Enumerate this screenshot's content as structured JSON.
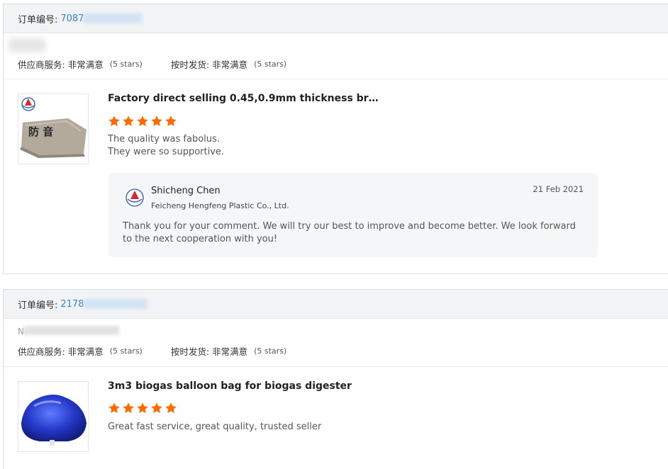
{
  "orders": [
    {
      "order_label": "订单编号:",
      "order_number_visible": "7087",
      "ratings": {
        "supplier_service_label": "供应商服务:",
        "supplier_service_value": "非常满意",
        "supplier_service_stars": "(5 stars)",
        "on_time_label": "按时发货:",
        "on_time_value": "非常满意",
        "on_time_stars": "(5 stars)"
      },
      "product": {
        "title": "Factory direct selling 0.45,0.9mm thickness br…",
        "rating": 5,
        "comment_lines": [
          "The quality was fabolus.",
          "They were so supportive."
        ],
        "image_text": "防 音"
      },
      "reply": {
        "name": "Shicheng Chen",
        "company": "Feicheng Hengfeng Plastic Co., Ltd.",
        "date": "21 Feb 2021",
        "text": "Thank you for your comment. We will try our best to improve and become better. We look forward to the next cooperation with you!"
      }
    },
    {
      "order_label": "订单编号:",
      "order_number_visible": "2178",
      "buyer_visible": "N",
      "ratings": {
        "supplier_service_label": "供应商服务:",
        "supplier_service_value": "非常满意",
        "supplier_service_stars": "(5 stars)",
        "on_time_label": "按时发货:",
        "on_time_value": "非常满意",
        "on_time_stars": "(5 stars)"
      },
      "product": {
        "title": "3m3 biogas balloon bag for biogas digester",
        "rating": 5,
        "comment": "Great fast service, great quality, trusted seller"
      }
    }
  ],
  "colors": {
    "accent_link": "#2f86d6",
    "star": "#ff6a00",
    "header_bg": "#f2f3f5",
    "reply_bg": "#f5f6f8"
  },
  "icons": {
    "star": "star-icon",
    "supplier_logo": "supplier-logo-icon"
  }
}
